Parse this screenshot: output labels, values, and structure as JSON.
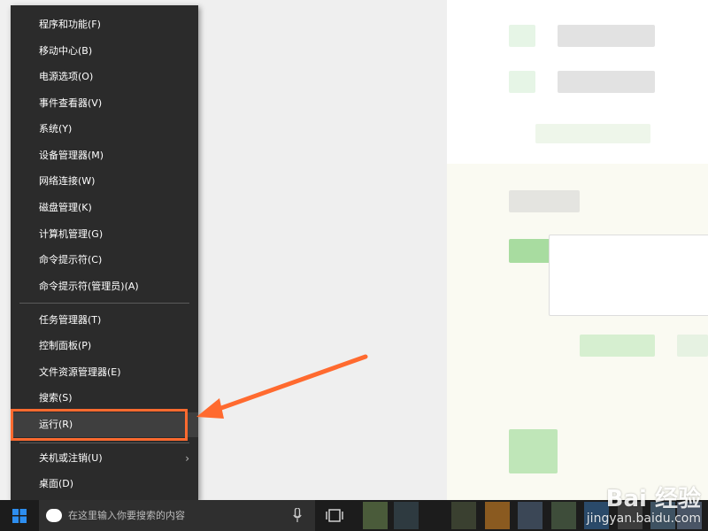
{
  "menu": {
    "items": [
      {
        "label": "程序和功能(F)"
      },
      {
        "label": "移动中心(B)"
      },
      {
        "label": "电源选项(O)"
      },
      {
        "label": "事件查看器(V)"
      },
      {
        "label": "系统(Y)"
      },
      {
        "label": "设备管理器(M)"
      },
      {
        "label": "网络连接(W)"
      },
      {
        "label": "磁盘管理(K)"
      },
      {
        "label": "计算机管理(G)"
      },
      {
        "label": "命令提示符(C)"
      },
      {
        "label": "命令提示符(管理员)(A)"
      },
      {
        "label": "任务管理器(T)"
      },
      {
        "label": "控制面板(P)"
      },
      {
        "label": "文件资源管理器(E)"
      },
      {
        "label": "搜索(S)"
      },
      {
        "label": "运行(R)"
      },
      {
        "label": "关机或注销(U)"
      },
      {
        "label": "桌面(D)"
      }
    ],
    "highlighted": "运行(R)"
  },
  "taskbar": {
    "search_placeholder": "在这里输入你要搜索的内容"
  },
  "watermark": {
    "brand": "Bai 经验",
    "url": "jingyan.baidu.com"
  },
  "colors": {
    "menu_bg": "#2b2b2b",
    "annotation": "#ff6a2f",
    "taskbar": "#1c1c1c"
  }
}
